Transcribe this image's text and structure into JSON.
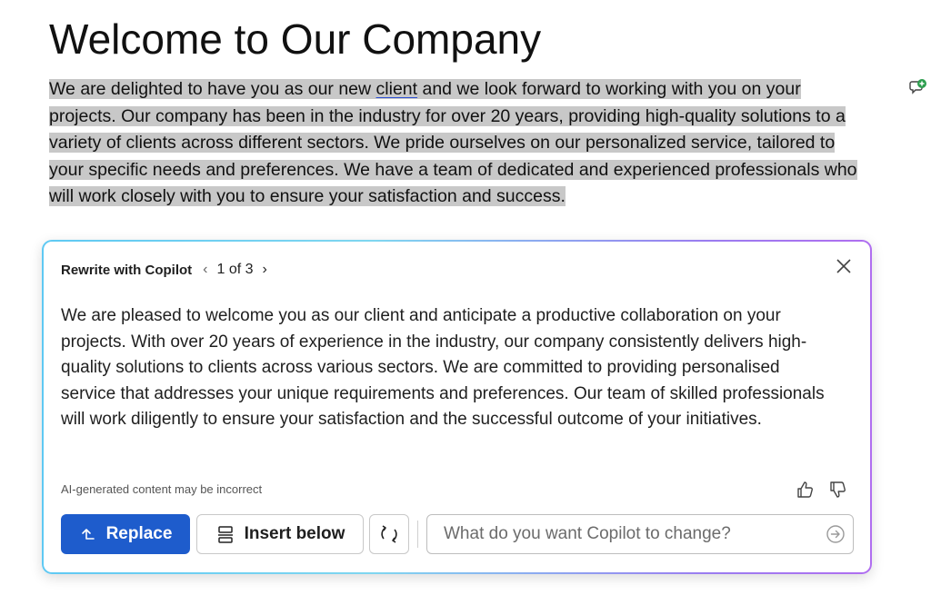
{
  "document": {
    "title": "Welcome to Our Company",
    "para_before_link": "We are delighted to have you as our new ",
    "para_link": "client",
    "para_after_link": " and we look forward to working with you on your projects. Our company has been in the industry for over 20 years, providing high-quality solutions to a variety of clients across different sectors. We pride ourselves on our personalized service, tailored to your specific needs and preferences. We have a team of dedicated and experienced professionals who will work closely with you to ensure your satisfaction and success."
  },
  "copilot": {
    "header_title": "Rewrite with Copilot",
    "page_indicator": "1 of 3",
    "rewrite_text": "We are pleased to welcome you as our client and anticipate a productive collaboration on your projects. With over 20 years of experience in the industry, our company consistently delivers high-quality solutions to clients across various sectors. We are committed to providing personalised service that addresses your unique requirements and preferences. Our team of skilled professionals will work diligently to ensure your satisfaction and the successful outcome of your initiatives.",
    "disclaimer": "AI-generated content may be incorrect",
    "replace_label": "Replace",
    "insert_below_label": "Insert below",
    "prompt_placeholder": "What do you want Copilot to change?",
    "accent_color": "#1e5ccc",
    "icons": [
      "chevron-left-icon",
      "chevron-right-icon",
      "close-icon",
      "thumbs-up-icon",
      "thumbs-down-icon",
      "replace-arrow-icon",
      "insert-below-icon",
      "regenerate-icon",
      "send-icon",
      "comment-add-icon"
    ]
  }
}
